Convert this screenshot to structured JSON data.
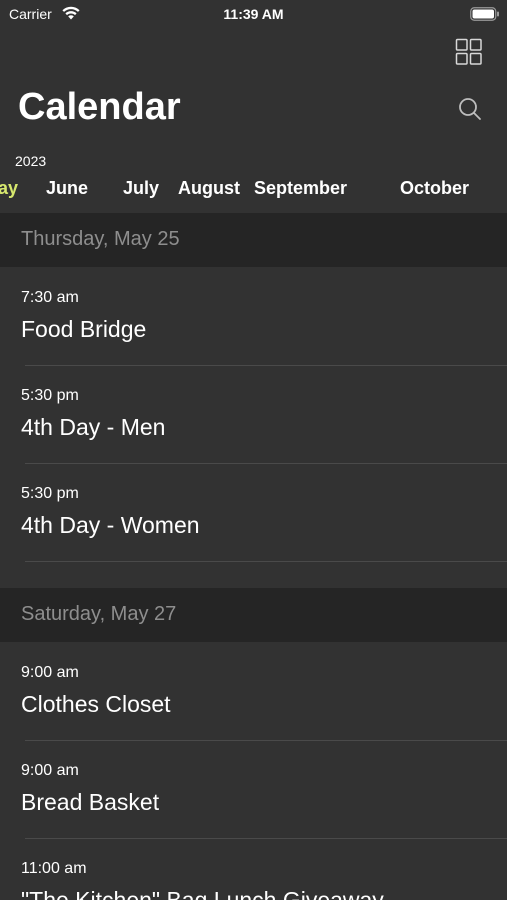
{
  "status_bar": {
    "carrier": "Carrier",
    "time": "11:39 AM",
    "wifi_icon": "wifi-icon",
    "battery_icon": "battery-icon"
  },
  "header": {
    "title": "Calendar",
    "grid_icon": "grid-icon",
    "search_icon": "search-icon"
  },
  "month_selector": {
    "year": "2023",
    "months": [
      {
        "label": "ay",
        "selected": true
      },
      {
        "label": "June",
        "selected": false
      },
      {
        "label": "July",
        "selected": false
      },
      {
        "label": "August",
        "selected": false
      },
      {
        "label": "September",
        "selected": false
      },
      {
        "label": "October",
        "selected": false
      }
    ]
  },
  "sections": [
    {
      "header": "Thursday, May 25",
      "events": [
        {
          "time": "7:30 am",
          "title": "Food Bridge"
        },
        {
          "time": "5:30 pm",
          "title": "4th Day - Men"
        },
        {
          "time": "5:30 pm",
          "title": "4th Day - Women"
        }
      ]
    },
    {
      "header": "Saturday, May 27",
      "events": [
        {
          "time": "9:00 am",
          "title": "Clothes Closet"
        },
        {
          "time": "9:00 am",
          "title": "Bread Basket"
        },
        {
          "time": "11:00 am",
          "title": "\"The Kitchen\" Bag Lunch Giveaway"
        }
      ]
    }
  ],
  "colors": {
    "background": "#323232",
    "section_header_bg": "#252525",
    "section_header_text": "#8e8e8e",
    "accent": "#d7e86e",
    "text": "#ffffff"
  }
}
